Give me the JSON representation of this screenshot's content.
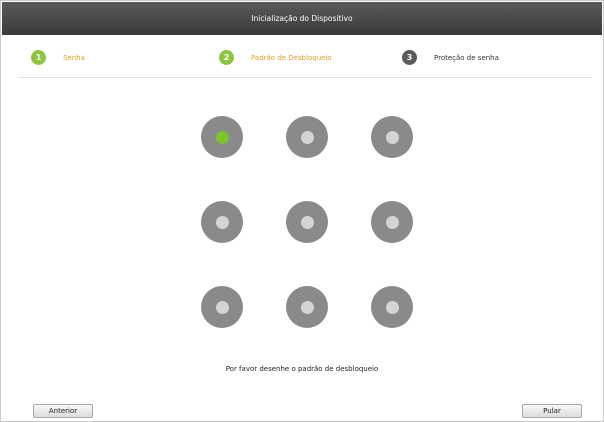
{
  "window": {
    "title": "Inicialização do Dispositivo"
  },
  "steps": [
    {
      "number": "1",
      "label": "Senha",
      "state": "done"
    },
    {
      "number": "2",
      "label": "Padrão de Desbloqueio",
      "state": "active"
    },
    {
      "number": "3",
      "label": "Proteção de senha",
      "state": "todo"
    }
  ],
  "pattern": {
    "rows": 3,
    "cols": 3,
    "selected_dots": [
      1
    ],
    "hint": "Por favor desenhe o padrão de desbloqueio"
  },
  "buttons": {
    "previous": "Anterior",
    "skip": "Pular"
  },
  "colors": {
    "accent_green": "#8cc63f",
    "step_label_active": "#e8a020",
    "dot_ring": "#8a8a8a",
    "dot_core": "#d4d4d4",
    "titlebar": "#444444"
  }
}
